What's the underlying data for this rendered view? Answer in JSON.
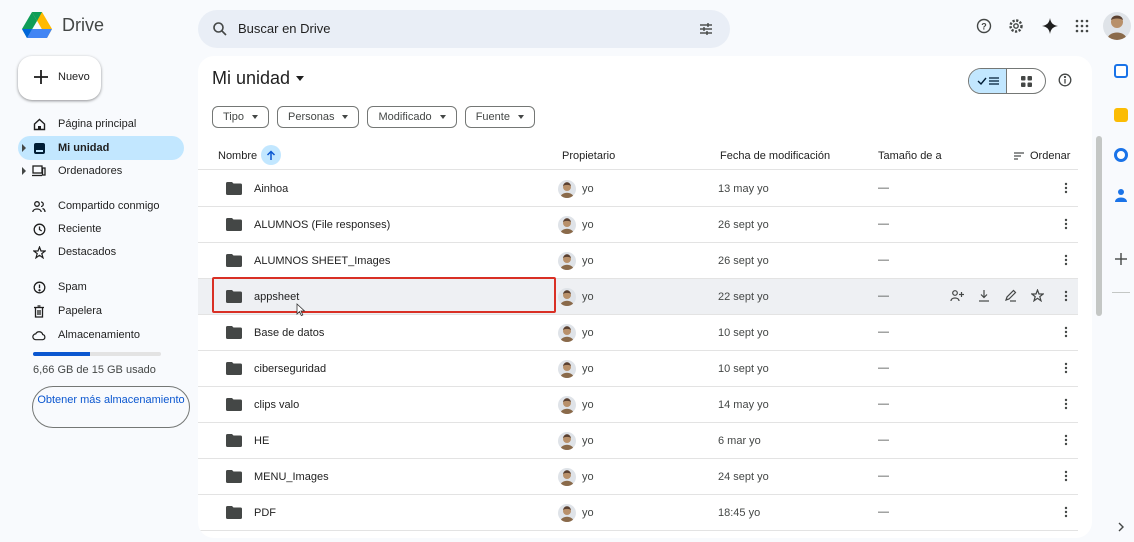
{
  "app": {
    "name": "Drive"
  },
  "search": {
    "placeholder": "Buscar en Drive"
  },
  "top_icons": [
    "help-icon",
    "settings-icon",
    "gemini-icon",
    "apps-grid-icon",
    "account-avatar"
  ],
  "sidebar": {
    "new_label": "Nuevo",
    "items": [
      {
        "label": "Página principal",
        "icon": "home-icon"
      },
      {
        "label": "Mi unidad",
        "icon": "drive-icon",
        "active": true
      },
      {
        "label": "Ordenadores",
        "icon": "computer-icon"
      },
      {
        "label": "Compartido conmigo",
        "icon": "shared-icon"
      },
      {
        "label": "Reciente",
        "icon": "clock-icon"
      },
      {
        "label": "Destacados",
        "icon": "star-icon"
      },
      {
        "label": "Spam",
        "icon": "spam-icon"
      },
      {
        "label": "Papelera",
        "icon": "trash-icon"
      },
      {
        "label": "Almacenamiento",
        "icon": "cloud-icon"
      }
    ],
    "storage_text": "6,66 GB de 15 GB usado",
    "storage_fraction": 0.444,
    "get_storage_label": "Obtener más almacenamiento"
  },
  "main": {
    "title": "Mi unidad",
    "filters": [
      "Tipo",
      "Personas",
      "Modificado",
      "Fuente"
    ],
    "columns": {
      "name": "Nombre",
      "owner": "Propietario",
      "modified": "Fecha de modificación",
      "size": "Tamaño de a",
      "sort": "Ordenar"
    },
    "rows": [
      {
        "name": "Ainhoa",
        "owner": "yo",
        "modified": "13 may yo",
        "size": "—"
      },
      {
        "name": "ALUMNOS (File responses)",
        "owner": "yo",
        "modified": "26 sept yo",
        "size": "—"
      },
      {
        "name": "ALUMNOS SHEET_Images",
        "owner": "yo",
        "modified": "26 sept yo",
        "size": "—"
      },
      {
        "name": "appsheet",
        "owner": "yo",
        "modified": "22 sept yo",
        "size": "—"
      },
      {
        "name": "Base de datos",
        "owner": "yo",
        "modified": "10 sept yo",
        "size": "—"
      },
      {
        "name": "ciberseguridad",
        "owner": "yo",
        "modified": "10 sept yo",
        "size": "—"
      },
      {
        "name": "clips valo",
        "owner": "yo",
        "modified": "14 may yo",
        "size": "—"
      },
      {
        "name": "HE",
        "owner": "yo",
        "modified": "6 mar yo",
        "size": "—"
      },
      {
        "name": "MENU_Images",
        "owner": "yo",
        "modified": "24 sept yo",
        "size": "—"
      },
      {
        "name": "PDF",
        "owner": "yo",
        "modified": "18:45 yo",
        "size": "—"
      }
    ]
  },
  "colors": {
    "accent": "#0b57d0",
    "active_bg": "#c2e7ff",
    "highlight": "#d93025",
    "background": "#f8fafd"
  }
}
